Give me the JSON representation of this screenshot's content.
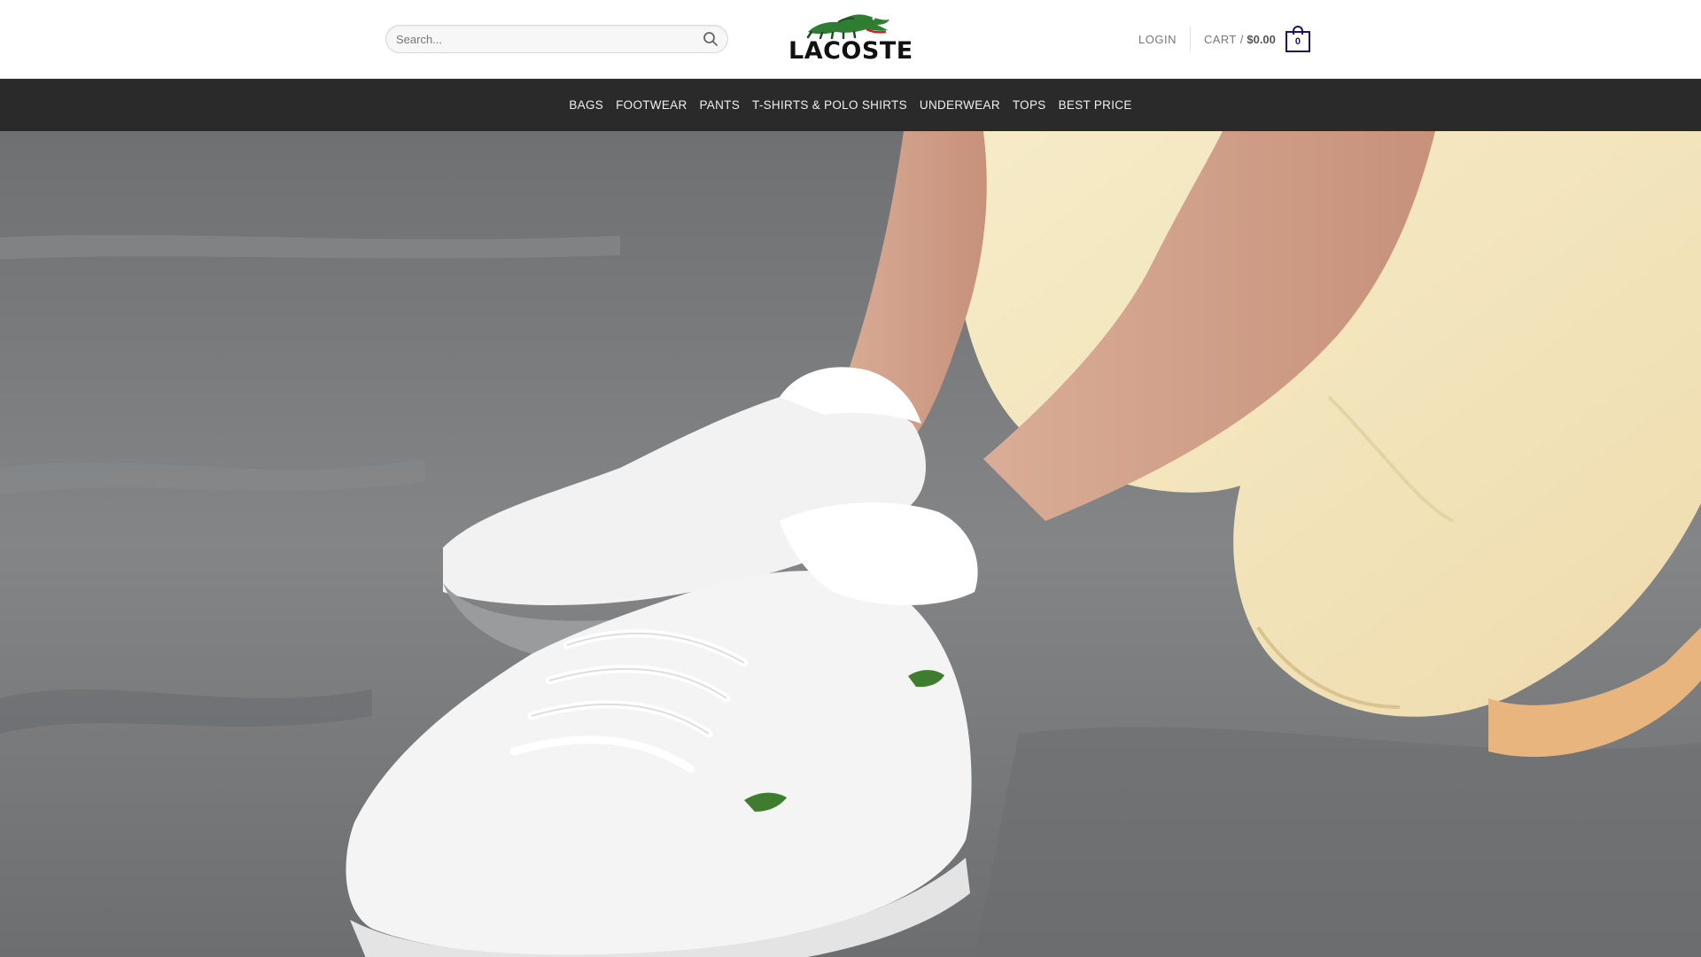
{
  "header": {
    "search": {
      "placeholder": "Search..."
    },
    "logo_text": "LACOSTE",
    "login_label": "LOGIN",
    "cart": {
      "label": "CART",
      "separator": "/",
      "amount": "$0.00",
      "count": "0"
    }
  },
  "nav": {
    "items": [
      {
        "label": "BAGS"
      },
      {
        "label": "FOOTWEAR"
      },
      {
        "label": "PANTS"
      },
      {
        "label": "T-SHIRTS & POLO SHIRTS"
      },
      {
        "label": "UNDERWEAR"
      },
      {
        "label": "TOPS"
      },
      {
        "label": "BEST PRICE"
      }
    ]
  },
  "colors": {
    "nav_background": "#2a2a2a",
    "cart_accent": "#1b1464",
    "logo_green": "#2e7d32"
  },
  "icons": {
    "search": "search-icon",
    "cart": "shopping-bag-icon",
    "logo": "crocodile-logo"
  }
}
